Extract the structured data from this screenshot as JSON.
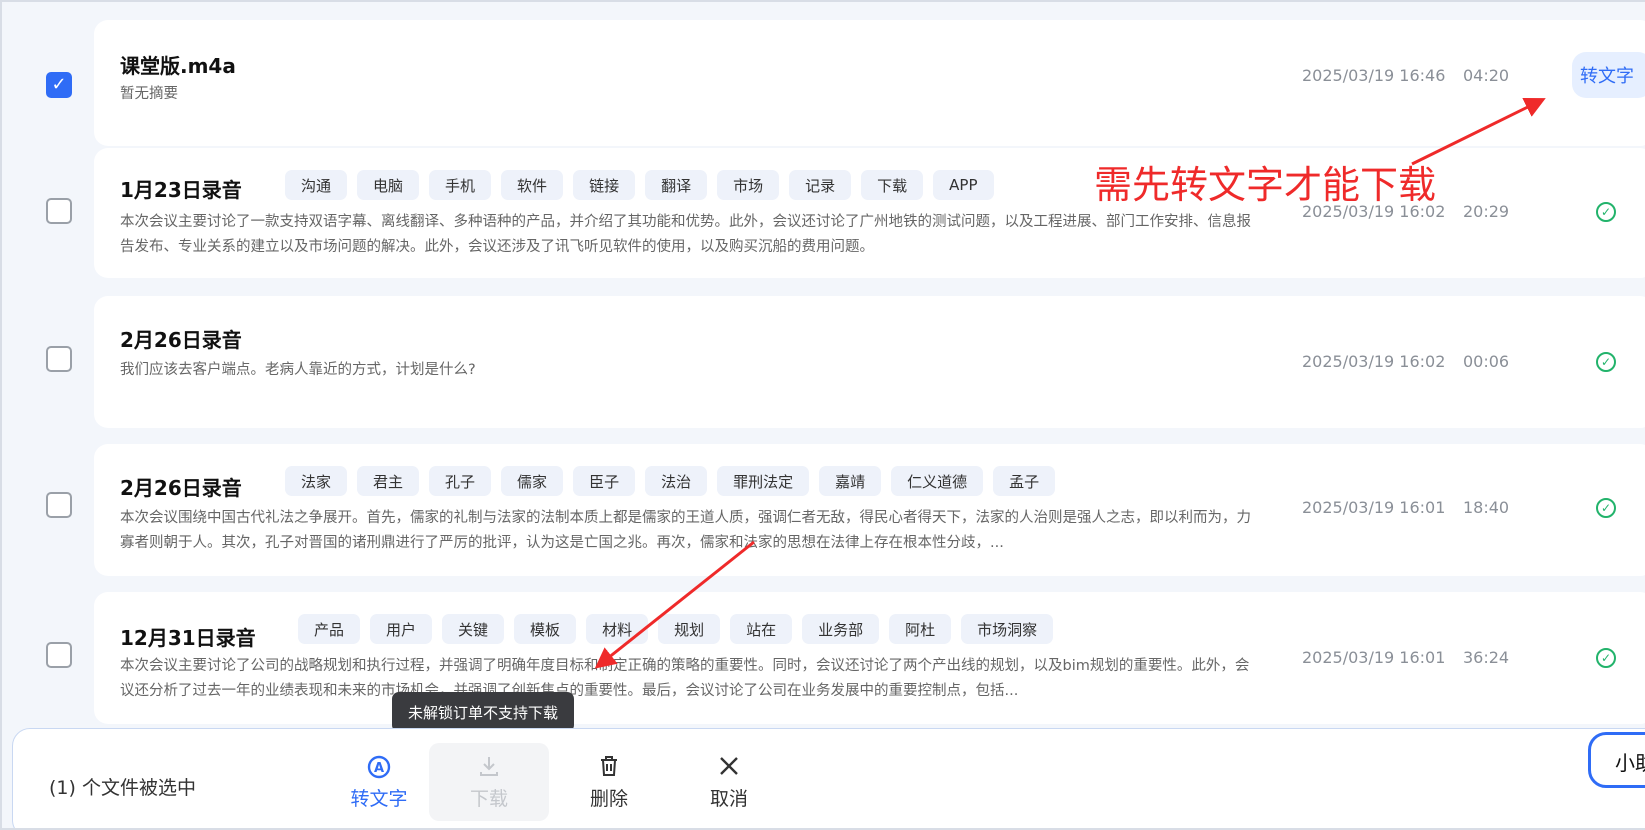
{
  "rows": [
    {
      "title": "课堂版.m4a",
      "checked": true,
      "tags": [],
      "summary": "暂无摘要",
      "date": "2025/03/19 16:46",
      "duration": "04:20",
      "action": "转文字"
    },
    {
      "title": "1月23日录音",
      "checked": false,
      "tags": [
        "沟通",
        "电脑",
        "手机",
        "软件",
        "链接",
        "翻译",
        "市场",
        "记录",
        "下载",
        "APP"
      ],
      "summary": "本次会议主要讨论了一款支持双语字幕、离线翻译、多种语种的产品，并介绍了其功能和优势。此外，会议还讨论了广州地铁的测试问题，以及工程进展、部门工作安排、信息报告发布、专业关系的建立以及市场问题的解决。此外，会议还涉及了讯飞听见软件的使用，以及购买沉船的费用问题。",
      "date": "2025/03/19 16:02",
      "duration": "20:29",
      "status_icon": "check-circle-icon"
    },
    {
      "title": "2月26日录音",
      "checked": false,
      "tags": [],
      "summary": "我们应该去客户端点。老病人靠近的方式，计划是什么?",
      "date": "2025/03/19 16:02",
      "duration": "00:06",
      "status_icon": "check-circle-icon"
    },
    {
      "title": "2月26日录音",
      "checked": false,
      "tags": [
        "法家",
        "君主",
        "孔子",
        "儒家",
        "臣子",
        "法治",
        "罪刑法定",
        "嘉靖",
        "仁义道德",
        "孟子"
      ],
      "summary": "本次会议围绕中国古代礼法之争展开。首先，儒家的礼制与法家的法制本质上都是儒家的王道人质，强调仁者无敌，得民心者得天下，法家的人治则是强人之志，即以利而为，力寡者则朝于人。其次，孔子对晋国的诸刑鼎进行了严厉的批评，认为这是亡国之兆。再次，儒家和法家的思想在法律上存在根本性分歧，...",
      "date": "2025/03/19 16:01",
      "duration": "18:40",
      "status_icon": "check-circle-icon"
    },
    {
      "title": "12月31日录音",
      "checked": false,
      "tags": [
        "产品",
        "用户",
        "关键",
        "模板",
        "材料",
        "规划",
        "站在",
        "业务部",
        "阿杜",
        "市场洞察"
      ],
      "summary": "本次会议主要讨论了公司的战略规划和执行过程，并强调了明确年度目标和制定正确的策略的重要性。同时，会议还讨论了两个产出线的规划，以及bim规划的重要性。此外，会议还分析了过去一年的业绩表现和未来的市场机会，并强调了创新焦点的重要性。最后，会议讨论了公司在业务发展中的重要控制点，包括...",
      "date": "2025/03/19 16:01",
      "duration": "36:24",
      "status_icon": "check-circle-icon"
    }
  ],
  "annotation": "需先转文字才能下载",
  "tooltip": "未解锁订单不支持下载",
  "bottom_bar": {
    "selected_text": "(1) 个文件被选中",
    "actions": [
      {
        "label": "转文字",
        "icon": "convert-text-icon"
      },
      {
        "label": "下载",
        "icon": "download-icon"
      },
      {
        "label": "删除",
        "icon": "trash-icon"
      },
      {
        "label": "取消",
        "icon": "close-icon"
      }
    ]
  },
  "assistant_label": "小助",
  "colors": {
    "accent": "#2f6cf6",
    "success": "#22b36b",
    "annotation": "#ef2a2a"
  }
}
